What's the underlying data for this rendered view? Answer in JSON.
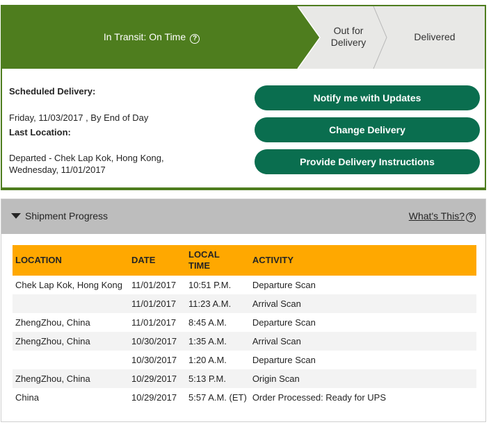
{
  "progress": {
    "current_step": "In Transit: On Time",
    "help_icon": "?",
    "step_out_line1": "Out for",
    "step_out_line2": "Delivery",
    "step_delivered": "Delivered",
    "colors": {
      "current": "#4e7d1e",
      "pending": "#e8e8e6"
    }
  },
  "delivery": {
    "scheduled_label": "Scheduled Delivery:",
    "scheduled_value": "Friday, 11/03/2017 , By End of Day",
    "last_location_label": "Last Location:",
    "last_location_line1": "Departed - Chek Lap Kok, Hong Kong,",
    "last_location_line2": "Wednesday, 11/01/2017"
  },
  "actions": {
    "notify": "Notify me with Updates",
    "change": "Change Delivery",
    "instructions": "Provide Delivery Instructions",
    "color": "#0a6e4f"
  },
  "shipment": {
    "toggle_label": "Shipment Progress",
    "whats_this": "What's This?",
    "help_icon": "?",
    "columns": {
      "location": "LOCATION",
      "date": "DATE",
      "time_line1": "LOCAL",
      "time_line2": "TIME",
      "activity": "ACTIVITY"
    },
    "rows": [
      {
        "location": "Chek Lap Kok,  Hong Kong",
        "date": "11/01/2017",
        "time": "10:51 P.M.",
        "activity": "Departure Scan"
      },
      {
        "location": "",
        "date": "11/01/2017",
        "time": "11:23 A.M.",
        "activity": "Arrival Scan"
      },
      {
        "location": "ZhengZhou,  China",
        "date": "11/01/2017",
        "time": "8:45 A.M.",
        "activity": "Departure Scan"
      },
      {
        "location": "ZhengZhou,  China",
        "date": "10/30/2017",
        "time": "1:35 A.M.",
        "activity": "Arrival Scan"
      },
      {
        "location": "",
        "date": "10/30/2017",
        "time": "1:20 A.M.",
        "activity": "Departure Scan"
      },
      {
        "location": "ZhengZhou,  China",
        "date": "10/29/2017",
        "time": "5:13 P.M.",
        "activity": "Origin Scan"
      },
      {
        "location": "China",
        "date": "10/29/2017",
        "time": "5:57 A.M. (ET)",
        "activity": "Order Processed: Ready for UPS"
      }
    ],
    "header_color": "#ffa800"
  }
}
